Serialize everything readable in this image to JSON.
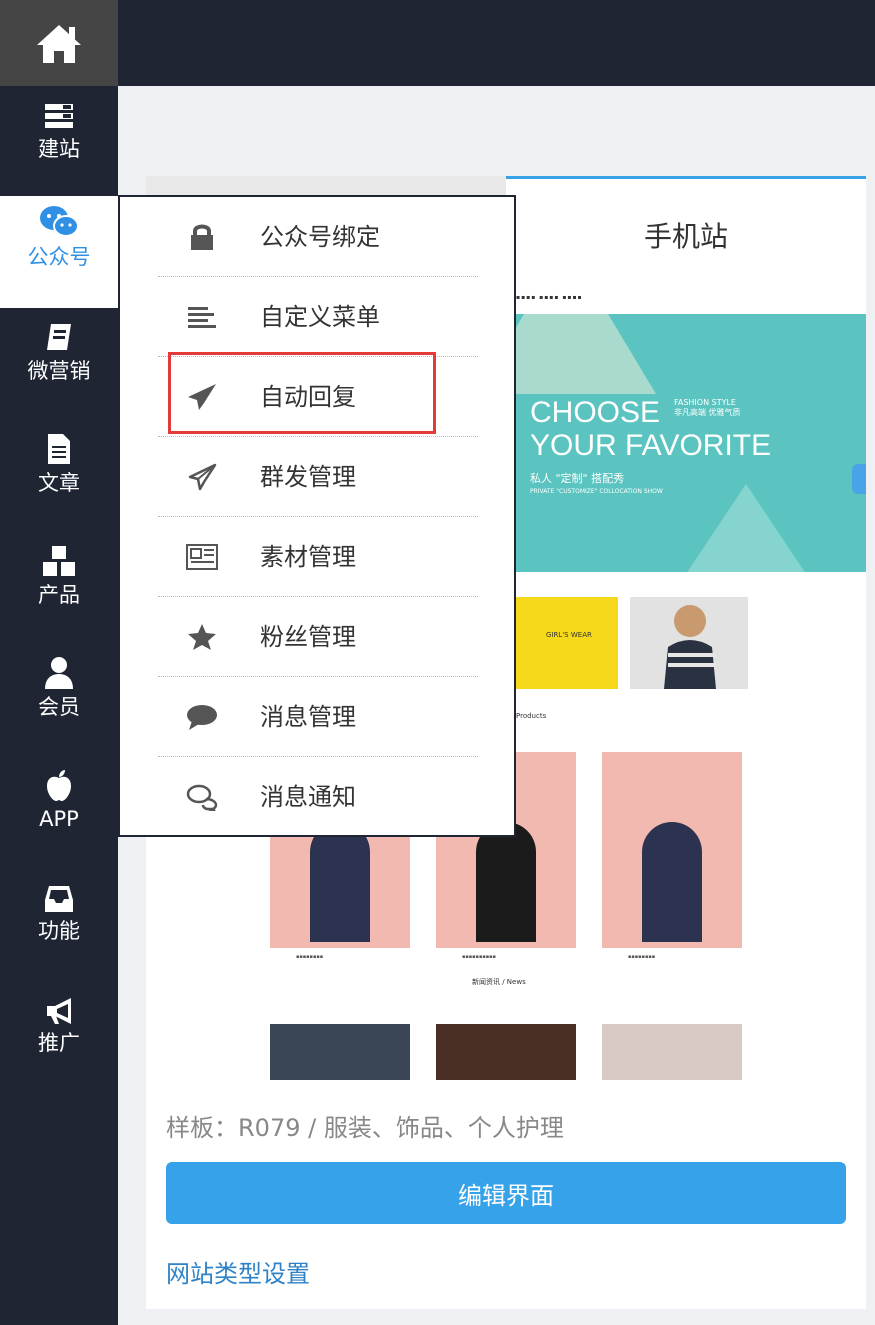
{
  "sidebar": {
    "items": [
      {
        "label": "建站",
        "icon": "server-icon"
      },
      {
        "label": "公众号",
        "icon": "wechat-icon"
      },
      {
        "label": "微营销",
        "icon": "book-icon"
      },
      {
        "label": "文章",
        "icon": "document-icon"
      },
      {
        "label": "产品",
        "icon": "cubes-icon"
      },
      {
        "label": "会员",
        "icon": "user-icon"
      },
      {
        "label": "APP",
        "icon": "apple-icon"
      },
      {
        "label": "功能",
        "icon": "inbox-icon"
      },
      {
        "label": "推广",
        "icon": "megaphone-icon"
      }
    ],
    "active_item": "公众号"
  },
  "submenu": {
    "items": [
      {
        "label": "公众号绑定",
        "icon": "lock-icon"
      },
      {
        "label": "自定义菜单",
        "icon": "menu-lines-icon"
      },
      {
        "label": "自动回复",
        "icon": "send-filled-icon"
      },
      {
        "label": "群发管理",
        "icon": "send-outline-icon"
      },
      {
        "label": "素材管理",
        "icon": "newspaper-icon"
      },
      {
        "label": "粉丝管理",
        "icon": "star-icon"
      },
      {
        "label": "消息管理",
        "icon": "speech-bubble-icon"
      },
      {
        "label": "消息通知",
        "icon": "chat-bubbles-icon"
      }
    ],
    "highlighted_item": "自动回复"
  },
  "main": {
    "tab_mobile": "手机站",
    "preview": {
      "banner_line1": "CHOOSE",
      "banner_small_1": "FASHION STYLE",
      "banner_small_2": "非凡高端 优雅气质",
      "banner_line2": "YOUR FAVORITE",
      "banner_cn": "私人 \"定制\" 搭配秀",
      "banner_en": "PRIVATE \"CUSTOMIZE\" COLLOCATION SHOW",
      "products_label": "Products",
      "news_label": "新闻资讯 / News"
    },
    "sample_text": "样板：R079 / 服装、饰品、个人护理",
    "edit_button": "编辑界面",
    "site_type_link": "网站类型设置"
  },
  "colors": {
    "sidebar_bg": "#1f2533",
    "accent_blue": "#35a2ea",
    "highlight_red": "#e43a3a",
    "active_text": "#2f90e6"
  }
}
